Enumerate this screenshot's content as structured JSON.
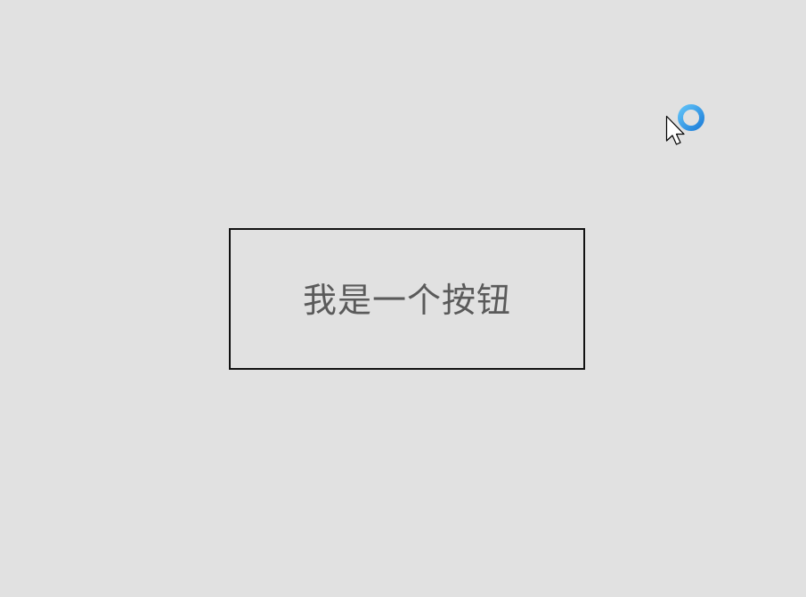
{
  "main_button": {
    "label": "我是一个按钮"
  },
  "cursor": {
    "pointer_icon": "arrow-pointer-icon",
    "busy_icon": "busy-ring-icon",
    "busy_color": "#2d96e8"
  },
  "colors": {
    "background": "#e1e1e1",
    "button_border": "#111111",
    "button_text": "#5a5a5a"
  }
}
